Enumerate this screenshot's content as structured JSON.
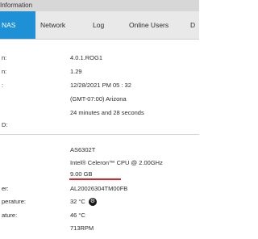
{
  "window": {
    "title": "Information"
  },
  "tabs": [
    {
      "label": "NAS",
      "active": true
    },
    {
      "label": "Network"
    },
    {
      "label": "Log"
    },
    {
      "label": "Online Users"
    },
    {
      "label": "D"
    }
  ],
  "system": {
    "rows": [
      {
        "label": "n:",
        "value": "4.0.1.ROG1"
      },
      {
        "label": "n:",
        "value": "1.29"
      },
      {
        "label": ":",
        "value": "12/28/2021  PM 05 : 32"
      },
      {
        "label": "",
        "value": "(GMT-07:00) Arizona"
      },
      {
        "label": "",
        "value": "24 minutes and 28 seconds"
      },
      {
        "label": "D:",
        "value": ""
      }
    ]
  },
  "hardware": {
    "rows": [
      {
        "label": "",
        "value": "AS6302T"
      },
      {
        "label": "",
        "value": "Intel® Celeron™ CPU @ 2.00GHz"
      },
      {
        "label": "",
        "value": "9.00 GB"
      },
      {
        "label": "er:",
        "value": "AL20026304TM00FB"
      },
      {
        "label": "perature:",
        "value": "32 °C"
      },
      {
        "label": "ature:",
        "value": "46 °C"
      },
      {
        "label": "",
        "value": "713RPM"
      }
    ]
  },
  "colors": {
    "accent": "#1e90d6",
    "highlight": "#d9252b",
    "tabbar": "#e9e9e9"
  }
}
